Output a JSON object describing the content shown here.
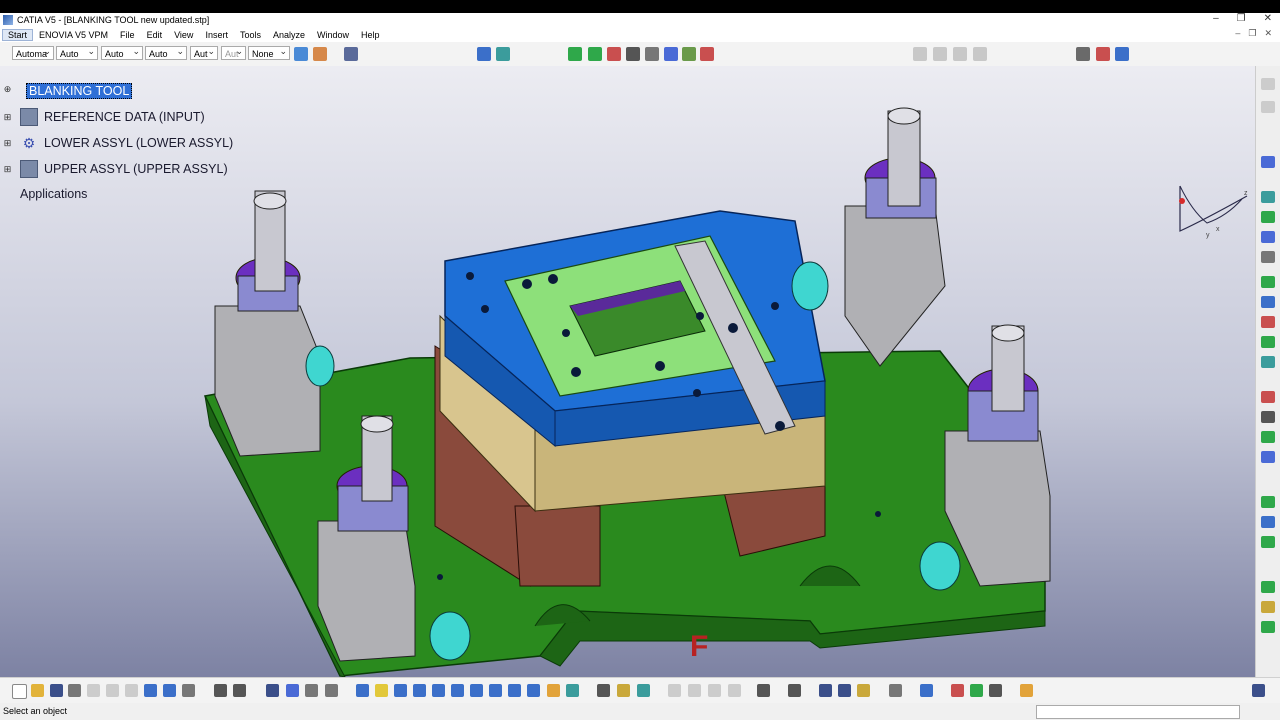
{
  "window": {
    "title": "CATIA V5 - [BLANKING TOOL new updated.stp]",
    "controls": [
      "–",
      "❐",
      "✕"
    ],
    "mdi_controls": [
      "–",
      "❐",
      "✕"
    ]
  },
  "menu": [
    "Start",
    "ENOVIA V5 VPM",
    "File",
    "Edit",
    "View",
    "Insert",
    "Tools",
    "Analyze",
    "Window",
    "Help"
  ],
  "toolbar": {
    "combos": [
      "Automa",
      "Auto",
      "Auto",
      "Auto",
      "Aut",
      "Aut",
      "None"
    ]
  },
  "tree": {
    "root": "BLANKING TOOL",
    "items": [
      {
        "label": "REFERENCE DATA (INPUT)"
      },
      {
        "label": "LOWER ASSYL (LOWER ASSYL)"
      },
      {
        "label": "UPPER ASSYL (UPPER ASSYL)"
      }
    ],
    "applications": "Applications"
  },
  "model": {
    "plate_mark": "F",
    "colors": {
      "base_plate": "#2a8a1e",
      "die_blue": "#1e6fd6",
      "stripper_green": "#8de07a",
      "spacer_tan": "#d8c58e",
      "block_brown": "#8a4a3c",
      "post_purple": "#6b2fc0",
      "clamp_cyan": "#3fd6d0",
      "bushing_gray": "#9a9a9a"
    }
  },
  "compass": {
    "axes": [
      "x",
      "y",
      "z"
    ]
  },
  "status": {
    "message": "Select an object"
  }
}
